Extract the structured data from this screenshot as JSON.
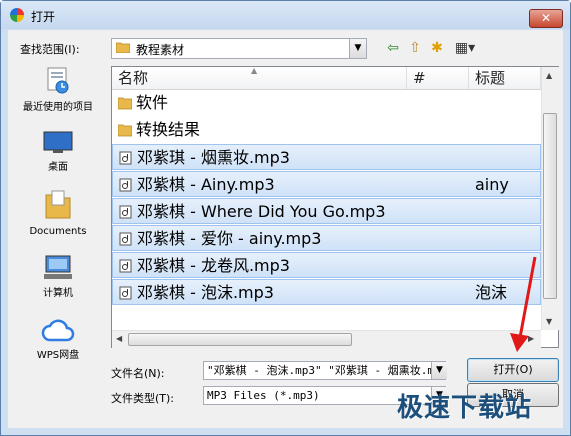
{
  "window": {
    "title": "打开",
    "close_label": "✕"
  },
  "lookin": {
    "label": "查找范围(I):",
    "value": "教程素材"
  },
  "toolbar": {
    "back": "⇦",
    "up": "⇧",
    "newfolder": "✱",
    "views": "▦▾"
  },
  "places": [
    {
      "label": "最近使用的项目",
      "icon": "recent-icon"
    },
    {
      "label": "桌面",
      "icon": "desktop-icon"
    },
    {
      "label": "Documents",
      "icon": "documents-icon"
    },
    {
      "label": "计算机",
      "icon": "computer-icon"
    },
    {
      "label": "WPS网盘",
      "icon": "cloud-icon"
    }
  ],
  "list": {
    "columns": {
      "name": "名称",
      "number": "#",
      "title": "标题"
    },
    "rows": [
      {
        "name": "软件",
        "type": "folder",
        "title": "",
        "selected": false
      },
      {
        "name": "转换结果",
        "type": "folder",
        "title": "",
        "selected": false
      },
      {
        "name": "邓紫琪 - 烟熏妆.mp3",
        "type": "mp3",
        "title": "",
        "selected": true
      },
      {
        "name": "邓紫棋 - Ainy.mp3",
        "type": "mp3",
        "title": "ainy",
        "selected": true
      },
      {
        "name": "邓紫棋 - Where Did You Go.mp3",
        "type": "mp3",
        "title": "",
        "selected": true
      },
      {
        "name": "邓紫棋 - 爱你 - ainy.mp3",
        "type": "mp3",
        "title": "",
        "selected": true
      },
      {
        "name": "邓紫棋 - 龙卷风.mp3",
        "type": "mp3",
        "title": "",
        "selected": true
      },
      {
        "name": "邓紫棋 - 泡沫.mp3",
        "type": "mp3",
        "title": "泡沫",
        "selected": true
      }
    ]
  },
  "filename": {
    "label": "文件名(N):",
    "value": "\"邓紫棋 - 泡沫.mp3\" \"邓紫琪 - 烟熏妆.m"
  },
  "filetype": {
    "label": "文件类型(T):",
    "value": "MP3 Files (*.mp3)"
  },
  "buttons": {
    "open": "打开(O)",
    "cancel": "取消"
  },
  "watermark": "极速下载站",
  "colors": {
    "selection": "#cfe2f8",
    "titlebar": "#c5d8ef",
    "close": "#c8472f"
  }
}
